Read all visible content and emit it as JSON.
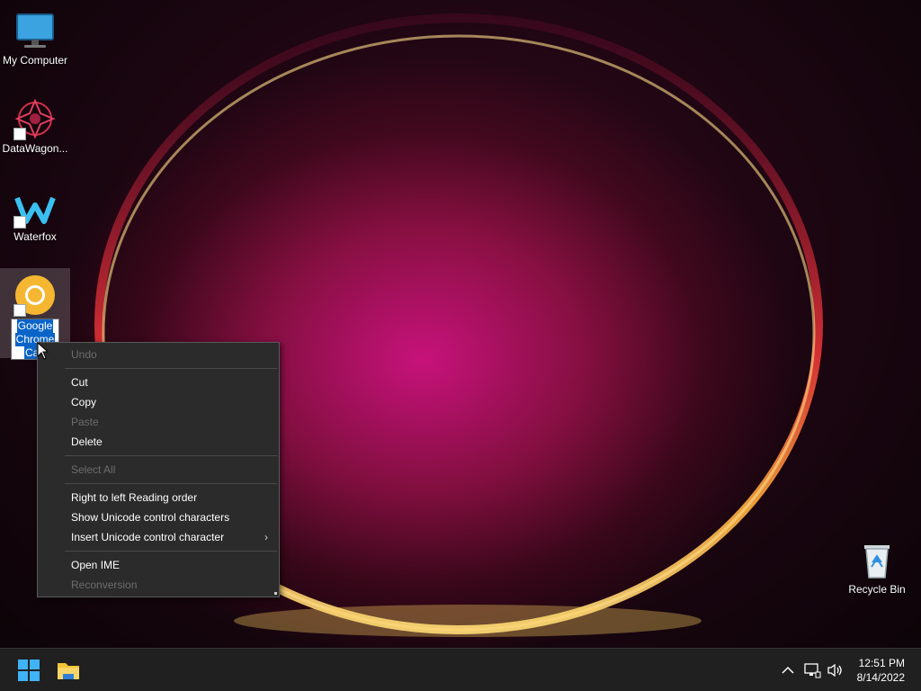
{
  "desktop": {
    "icons": [
      {
        "label": "My Computer"
      },
      {
        "label": "DataWagon..."
      },
      {
        "label": "Waterfox"
      },
      {
        "label_lines": [
          "Google",
          "Chrome",
          "Can"
        ]
      },
      {
        "label": "Recycle Bin"
      }
    ]
  },
  "context_menu": {
    "items": [
      {
        "label": "Undo",
        "enabled": false
      },
      {
        "label": "Cut",
        "enabled": true
      },
      {
        "label": "Copy",
        "enabled": true
      },
      {
        "label": "Paste",
        "enabled": false
      },
      {
        "label": "Delete",
        "enabled": true
      },
      {
        "label": "Select All",
        "enabled": false
      },
      {
        "label": "Right to left Reading order",
        "enabled": true
      },
      {
        "label": "Show Unicode control characters",
        "enabled": true
      },
      {
        "label": "Insert Unicode control character",
        "enabled": true,
        "submenu_glyph": "›"
      },
      {
        "label": "Open IME",
        "enabled": true
      },
      {
        "label": "Reconversion",
        "enabled": false
      }
    ]
  },
  "taskbar": {
    "start_icon": "windows-start-icon",
    "pinned": [
      "file-explorer-icon"
    ],
    "tray_icons": [
      "chevron-up-icon",
      "network-icon",
      "volume-icon"
    ],
    "clock": {
      "time": "12:51 PM",
      "date": "8/14/2022"
    }
  },
  "colors": {
    "taskbar": "#202020",
    "menu_bg": "#2b2b2b",
    "selection": "#0a64c8",
    "disabled_text": "#6d6d6d"
  }
}
